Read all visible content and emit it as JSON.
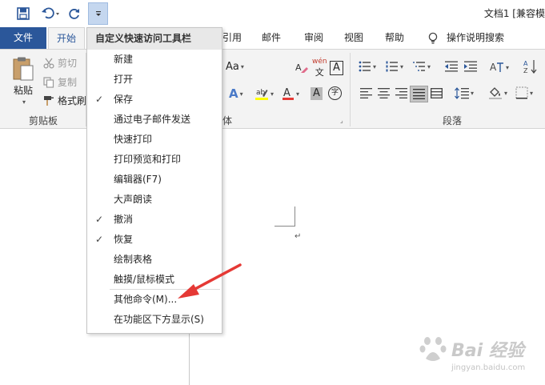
{
  "window": {
    "doc_title": "文档1 [兼容模"
  },
  "qat": {
    "save_icon": "save-icon",
    "undo_icon": "undo-icon",
    "redo_icon": "redo-icon",
    "customize_icon": "customize-qat-icon"
  },
  "tabs": [
    {
      "label": "文件"
    },
    {
      "label": "开始"
    },
    {
      "label": "引用"
    },
    {
      "label": "邮件"
    },
    {
      "label": "审阅"
    },
    {
      "label": "视图"
    },
    {
      "label": "帮助"
    },
    {
      "label": "操作说明搜索"
    }
  ],
  "clipboard": {
    "paste": "粘贴",
    "cut": "剪切",
    "copy": "复制",
    "format_painter": "格式刷",
    "group_label": "剪贴板"
  },
  "font_group": {
    "aa_label": "Aa",
    "wen_label": "wén",
    "a_label": "A",
    "group_label_fragment": "体"
  },
  "paragraph": {
    "group_label": "段落"
  },
  "menu": {
    "header": "自定义快速访问工具栏",
    "items": [
      {
        "label": "新建",
        "checked": false
      },
      {
        "label": "打开",
        "checked": false
      },
      {
        "label": "保存",
        "checked": true
      },
      {
        "label": "通过电子邮件发送",
        "checked": false
      },
      {
        "label": "快速打印",
        "checked": false
      },
      {
        "label": "打印预览和打印",
        "checked": false
      },
      {
        "label": "编辑器(F7)",
        "checked": false
      },
      {
        "label": "大声朗读",
        "checked": false
      },
      {
        "label": "撤消",
        "checked": true
      },
      {
        "label": "恢复",
        "checked": true
      },
      {
        "label": "绘制表格",
        "checked": false
      },
      {
        "label": "触摸/鼠标模式",
        "checked": false
      },
      {
        "label": "其他命令(M)...",
        "checked": false
      },
      {
        "label": "在功能区下方显示(S)",
        "checked": false
      }
    ],
    "check_glyph": "✓"
  },
  "document": {
    "para_mark": "↵"
  },
  "watermark": {
    "text": "Bai 经验",
    "sub": "jingyan.baidu.com"
  },
  "colors": {
    "file_tab": "#2b579a",
    "ribbon_bg": "#f3f3f3",
    "annotation_arrow": "#e53935",
    "customize_highlight": "#c5d7ef"
  }
}
